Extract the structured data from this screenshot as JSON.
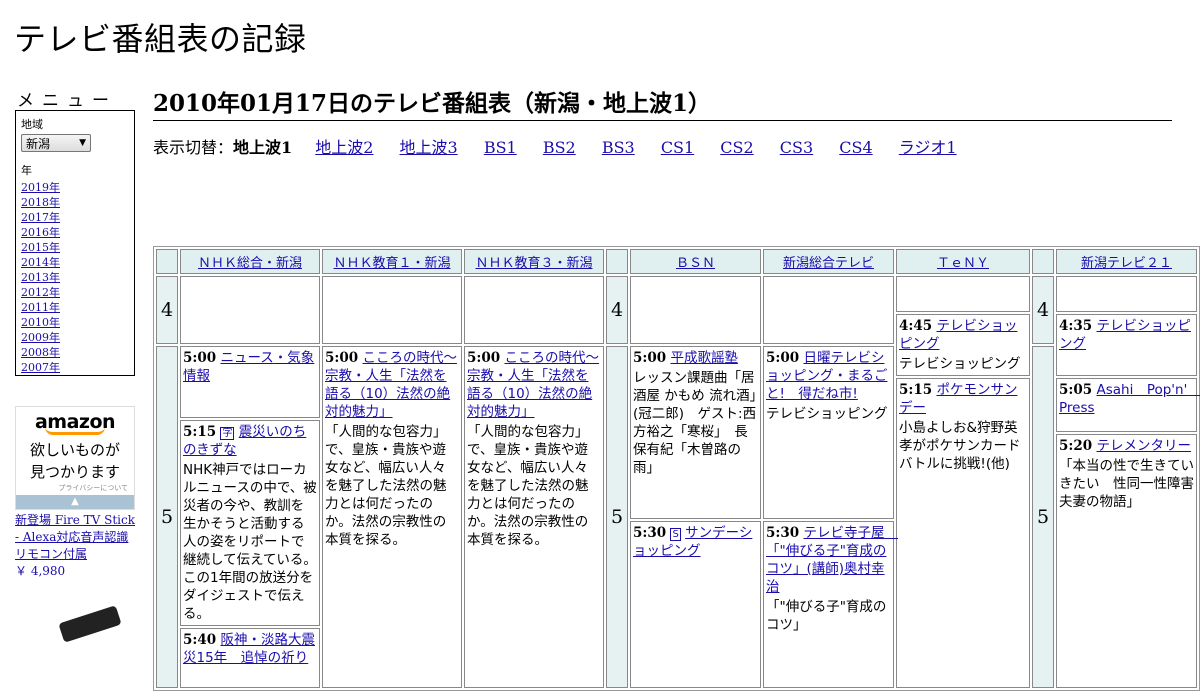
{
  "site_title": "テレビ番組表の記録",
  "menu": {
    "title": "メニュー",
    "region_label": "地域",
    "region_selected": "新潟",
    "year_label": "年",
    "years": [
      "2019年",
      "2018年",
      "2017年",
      "2016年",
      "2015年",
      "2014年",
      "2013年",
      "2012年",
      "2011年",
      "2010年",
      "2009年",
      "2008年",
      "2007年"
    ]
  },
  "ad": {
    "brand": "amazon",
    "tagline1": "欲しいものが",
    "tagline2": "見つかります",
    "privacy": "プライバシーについて",
    "product": "新登場 Fire TV Stick - Alexa対応音声認識リモコン付属",
    "price": "￥ 4,980"
  },
  "heading": "2010年01月17日のテレビ番組表（新潟・地上波1）",
  "switcher": {
    "label": "表示切替：",
    "current": "地上波1",
    "links": [
      "地上波2",
      "地上波3",
      "BS1",
      "BS2",
      "BS3",
      "CS1",
      "CS2",
      "CS3",
      "CS4",
      "ラジオ1"
    ]
  },
  "channels": [
    "ＮＨＫ総合・新潟",
    "ＮＨＫ教育１・新潟",
    "ＮＨＫ教育３・新潟",
    "ＢＳＮ",
    "新潟総合テレビ",
    "ＴｅＮＹ",
    "新潟テレビ２１"
  ],
  "hours": [
    "4",
    "5"
  ],
  "programs": {
    "nhk_sogo_1": {
      "time": "5:00",
      "title": "ニュース・気象情報"
    },
    "nhk_sogo_2": {
      "time": "5:15",
      "badge": "字",
      "title": "震災いのちのきずな",
      "desc": "NHK神戸ではローカルニュースの中で、被災者の今や、教訓を生かそうと活動する人の姿をリポートで継続して伝えている。この1年間の放送分をダイジェストで伝える。"
    },
    "nhk_sogo_3": {
      "time": "5:40",
      "title": "阪神・淡路大震災15年　追悼の祈り"
    },
    "nhk_edu1": {
      "time": "5:00",
      "title": "こころの時代～宗教・人生「法然を語る（10）法然の絶対的魅力」",
      "desc": "「人間的な包容力」で、皇族・貴族や遊女など、幅広い人々を魅了した法然の魅力とは何だったのか。法然の宗教性の本質を探る。"
    },
    "nhk_edu3": {
      "time": "5:00",
      "title": "こころの時代～宗教・人生「法然を語る（10）法然の絶対的魅力」",
      "desc": "「人間的な包容力」で、皇族・貴族や遊女など、幅広い人々を魅了した法然の魅力とは何だったのか。法然の宗教性の本質を探る。"
    },
    "bsn_1": {
      "time": "5:00",
      "title": "平成歌謡塾",
      "desc": "レッスン課題曲「居酒屋 かもめ 流れ酒」(冠二郎)　ゲスト:西方裕之「寒桜」　長保有紀「木曽路の雨」"
    },
    "bsn_2": {
      "time": "5:30",
      "badge": "S",
      "title": "サンデーショッピング"
    },
    "nst_1": {
      "time": "5:00",
      "title": "日曜テレビショッピング・まるごと!　得だね市!",
      "desc": "テレビショッピング"
    },
    "nst_2": {
      "time": "5:30",
      "title": "テレビ寺子屋　「\"伸びる子\"育成のコツ」(講師)奥村幸治",
      "desc": "「\"伸びる子\"育成のコツ」"
    },
    "teny_1": {
      "time": "4:45",
      "title": "テレビショッピング",
      "desc": "テレビショッピング"
    },
    "teny_2": {
      "time": "5:15",
      "title": "ポケモンサンデー",
      "desc": "小島よしお&狩野英孝がポケサンカードバトルに挑戦!(他)"
    },
    "ut21_1": {
      "time": "4:35",
      "title": "テレビショッピング"
    },
    "ut21_2": {
      "time": "5:05",
      "title": "Asahi　Pop'n'　Press"
    },
    "ut21_3": {
      "time": "5:20",
      "title": "テレメンタリー",
      "desc": "「本当の性で生きていきたい　性同一性障害夫妻の物語」"
    }
  }
}
